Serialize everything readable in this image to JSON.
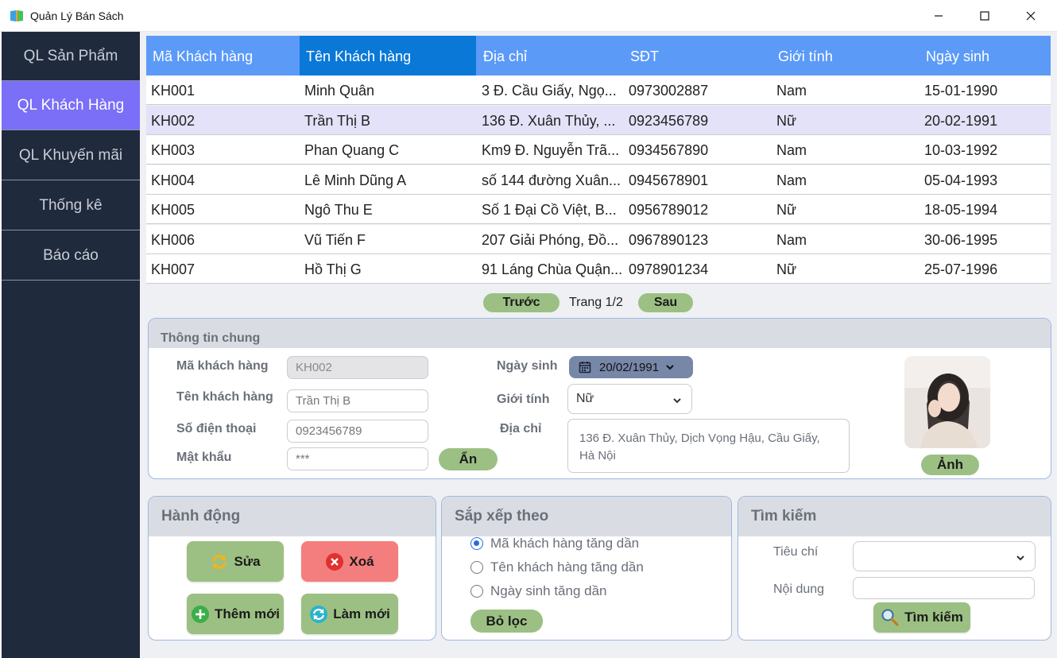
{
  "window": {
    "title": "Quản Lý Bán Sách"
  },
  "sidebar": {
    "items": [
      {
        "label": "QL Sản Phẩm"
      },
      {
        "label": "QL Khách Hàng"
      },
      {
        "label": "QL Khuyến mãi"
      },
      {
        "label": "Thống kê"
      },
      {
        "label": "Báo cáo"
      }
    ],
    "active_index": 1
  },
  "table": {
    "columns": [
      "Mã Khách hàng",
      "Tên Khách hàng",
      "Địa chỉ",
      "SĐT",
      "Giới tính",
      "Ngày sinh"
    ],
    "selected_column_index": 1,
    "selected_row_index": 1,
    "rows": [
      [
        "KH001",
        "Minh Quân",
        "3 Đ. Cầu Giấy, Ngọ...",
        "0973002887",
        "Nam",
        "15-01-1990"
      ],
      [
        "KH002",
        "Trần Thị B",
        "136 Đ. Xuân Thủy, ...",
        "0923456789",
        "Nữ",
        "20-02-1991"
      ],
      [
        "KH003",
        "Phan Quang C",
        "Km9 Đ. Nguyễn Trã...",
        "0934567890",
        "Nam",
        "10-03-1992"
      ],
      [
        "KH004",
        "Lê Minh Dũng A",
        "số 144 đường Xuân...",
        "0945678901",
        "Nam",
        "05-04-1993"
      ],
      [
        "KH005",
        "Ngô Thu E",
        "Số 1 Đại Cồ Việt, B...",
        "0956789012",
        "Nữ",
        "18-05-1994"
      ],
      [
        "KH006",
        "Vũ Tiến F",
        "207 Giải Phóng, Đồ...",
        "0967890123",
        "Nam",
        "30-06-1995"
      ],
      [
        "KH007",
        "Hồ Thị G",
        "91 Láng Chùa Quận...",
        "0978901234",
        "Nữ",
        "25-07-1996"
      ]
    ]
  },
  "pagination": {
    "prev_label": "Trước",
    "page_text": "Trang 1/2",
    "next_label": "Sau"
  },
  "info": {
    "title": "Thông tin chung",
    "code_label": "Mã khách hàng",
    "code_value": "KH002",
    "name_label": "Tên khách hàng",
    "name_value": "Trần Thị B",
    "phone_label": "Số điện thoại",
    "phone_value": "0923456789",
    "password_label": "Mật khẩu",
    "password_value": "***",
    "hide_button": "Ẩn",
    "dob_label": "Ngày sinh",
    "dob_value": "20/02/1991",
    "gender_label": "Giới tính",
    "gender_value": "Nữ",
    "address_label": "Địa chỉ",
    "address_value": "136 Đ. Xuân Thủy, Dịch Vọng Hậu, Cầu Giấy, Hà Nội",
    "photo_button": "Ảnh"
  },
  "actions": {
    "title": "Hành động",
    "edit": "Sửa",
    "delete": "Xoá",
    "add": "Thêm mới",
    "refresh": "Làm mới"
  },
  "sort": {
    "title": "Sắp xếp theo",
    "options": [
      "Mã khách hàng tăng dần",
      "Tên khách hàng tăng dần",
      "Ngày sinh tăng dần"
    ],
    "selected_index": 0,
    "clear_button": "Bỏ lọc"
  },
  "search": {
    "title": "Tìm kiếm",
    "criteria_label": "Tiêu chí",
    "criteria_value": "",
    "content_label": "Nội dung",
    "content_value": "",
    "button": "Tìm kiếm"
  },
  "colors": {
    "sidebar_bg": "#1f2a3c",
    "active_nav": "#7b6ef7",
    "table_header": "#5b9af7",
    "selected_header": "#0a78d7",
    "button_green": "#9cc083",
    "button_red": "#f47e7e"
  }
}
